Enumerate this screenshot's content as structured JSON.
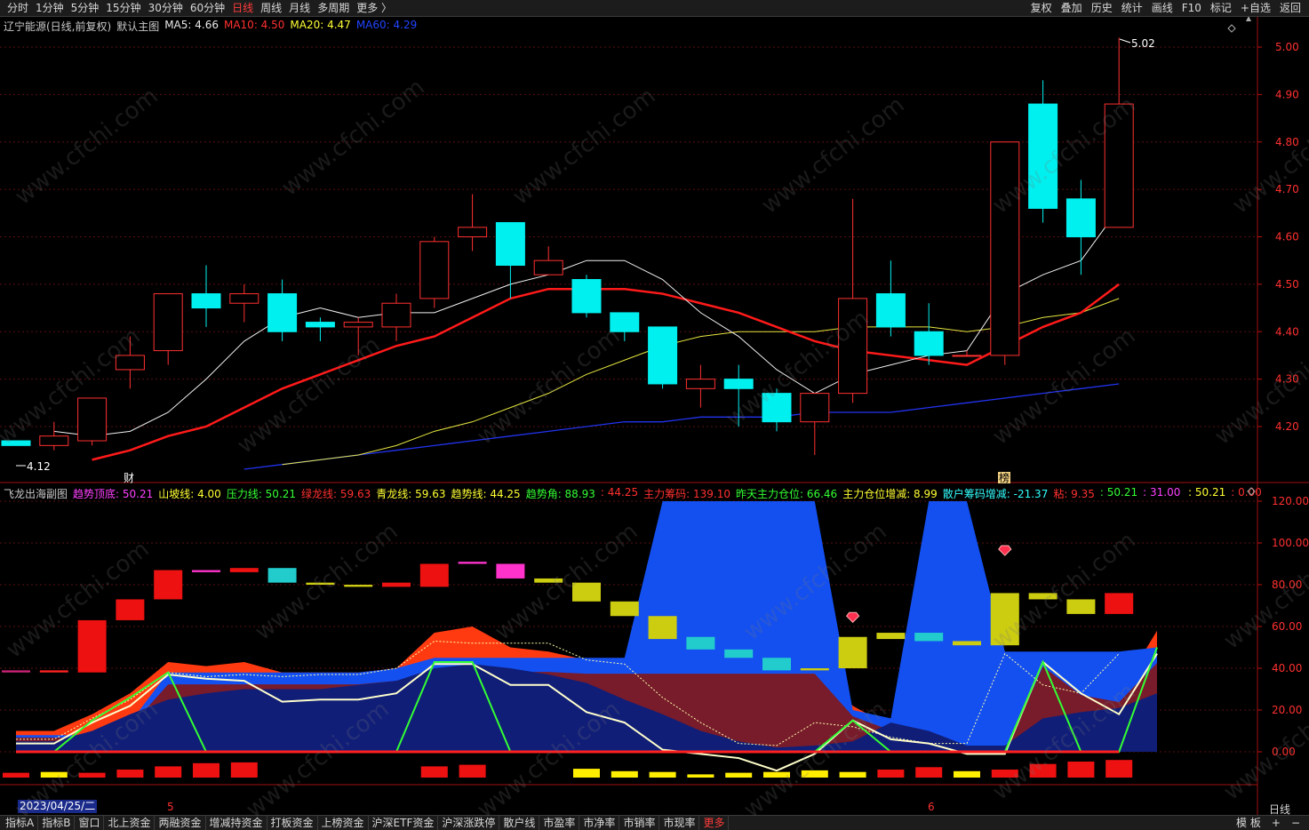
{
  "topbar": {
    "tabs": [
      "分时",
      "1分钟",
      "5分钟",
      "15分钟",
      "30分钟",
      "60分钟",
      "日线",
      "周线",
      "月线",
      "多周期",
      "更多 〉"
    ],
    "active": "日线",
    "right": [
      "复权",
      "叠加",
      "历史",
      "统计",
      "画线",
      "F10",
      "标记",
      "+自选",
      "返回"
    ]
  },
  "main_legend": [
    {
      "text": "辽宁能源(日线,前复权)",
      "color": "#c8c8c8"
    },
    {
      "text": "默认主图",
      "color": "#c8c8c8"
    },
    {
      "text": "MA5: 4.66",
      "color": "#e8e8e8"
    },
    {
      "text": "MA10: 4.50",
      "color": "#ff3030"
    },
    {
      "text": "MA20: 4.47",
      "color": "#ffff33"
    },
    {
      "text": "MA60: 4.29",
      "color": "#2244ff"
    }
  ],
  "sub_legend": [
    {
      "text": "飞龙出海副图",
      "color": "#c8c8c8"
    },
    {
      "text": "趋势顶底: 50.21",
      "color": "#ff40ff"
    },
    {
      "text": "山坡线: 4.00",
      "color": "#ffff33"
    },
    {
      "text": "压力线: 50.21",
      "color": "#33ff33"
    },
    {
      "text": "绿龙线: 59.63",
      "color": "#ff3030"
    },
    {
      "text": "青龙线: 59.63",
      "color": "#ffff33"
    },
    {
      "text": "趋势线: 44.25",
      "color": "#ffff33"
    },
    {
      "text": "趋势角: 88.93",
      "color": "#33ff33"
    },
    {
      "text": ": 44.25",
      "color": "#ff3030"
    },
    {
      "text": "主力筹码: 139.10",
      "color": "#ff3030"
    },
    {
      "text": "昨天主力仓位: 66.46",
      "color": "#33ff33"
    },
    {
      "text": "主力仓位增减: 8.99",
      "color": "#ffff33"
    },
    {
      "text": "散户筹码增减: -21.37",
      "color": "#33ffff"
    },
    {
      "text": "粘: 9.35",
      "color": "#ff3030"
    },
    {
      "text": ": 50.21",
      "color": "#33ff33"
    },
    {
      "text": ": 31.00",
      "color": "#ff40ff"
    }
  ],
  "sub_legend_right": [
    {
      "text": ": 50.21",
      "color": "#ffff33"
    },
    {
      "text": ": 0.00",
      "color": "#ff3030"
    }
  ],
  "price_axis": [
    "5.00",
    "4.90",
    "4.80",
    "4.70",
    "4.60",
    "4.50",
    "4.40",
    "4.30",
    "4.20"
  ],
  "sub_axis": [
    "120.00",
    "100.00",
    "80.00",
    "60.00",
    "40.00",
    "20.00",
    "0.00"
  ],
  "annotations": {
    "high": "5.02",
    "low": "4.12",
    "cai": "财",
    "bang": "榜",
    "month5": "5",
    "month6": "6"
  },
  "candles": [
    [
      4.17,
      4.16,
      4.17,
      4.16
    ],
    [
      4.16,
      4.18,
      4.21,
      4.15
    ],
    [
      4.17,
      4.26,
      4.26,
      4.16
    ],
    [
      4.32,
      4.35,
      4.39,
      4.28
    ],
    [
      4.36,
      4.48,
      4.48,
      4.33
    ],
    [
      4.48,
      4.45,
      4.54,
      4.41
    ],
    [
      4.46,
      4.48,
      4.5,
      4.42
    ],
    [
      4.48,
      4.4,
      4.51,
      4.38
    ],
    [
      4.42,
      4.41,
      4.43,
      4.38
    ],
    [
      4.41,
      4.42,
      4.43,
      4.35
    ],
    [
      4.41,
      4.46,
      4.48,
      4.38
    ],
    [
      4.47,
      4.59,
      4.6,
      4.45
    ],
    [
      4.6,
      4.62,
      4.69,
      4.57
    ],
    [
      4.63,
      4.54,
      4.63,
      4.47
    ],
    [
      4.52,
      4.55,
      4.58,
      4.52
    ],
    [
      4.51,
      4.44,
      4.52,
      4.43
    ],
    [
      4.44,
      4.4,
      4.44,
      4.38
    ],
    [
      4.41,
      4.29,
      4.41,
      4.28
    ],
    [
      4.28,
      4.3,
      4.33,
      4.24
    ],
    [
      4.3,
      4.28,
      4.33,
      4.2
    ],
    [
      4.27,
      4.21,
      4.28,
      4.19
    ],
    [
      4.21,
      4.27,
      4.27,
      4.14
    ],
    [
      4.27,
      4.47,
      4.68,
      4.25
    ],
    [
      4.48,
      4.41,
      4.55,
      4.39
    ],
    [
      4.4,
      4.35,
      4.46,
      4.33
    ],
    [
      4.35,
      4.35,
      4.36,
      4.35
    ],
    [
      4.35,
      4.8,
      4.8,
      4.33
    ],
    [
      4.88,
      4.66,
      4.93,
      4.63
    ],
    [
      4.68,
      4.6,
      4.72,
      4.52
    ],
    [
      4.62,
      4.88,
      5.02,
      4.62
    ]
  ],
  "ma5": [
    4.19,
    4.18,
    4.19,
    4.23,
    4.3,
    4.38,
    4.43,
    4.45,
    4.43,
    4.44,
    4.44,
    4.47,
    4.5,
    4.52,
    4.55,
    4.55,
    4.51,
    4.44,
    4.39,
    4.32,
    4.27,
    4.31,
    4.33,
    4.35,
    4.36,
    4.48,
    4.52,
    4.55,
    4.66
  ],
  "ma10": [
    4.13,
    4.15,
    4.18,
    4.2,
    4.24,
    4.28,
    4.31,
    4.34,
    4.37,
    4.39,
    4.43,
    4.47,
    4.49,
    4.49,
    4.49,
    4.48,
    4.46,
    4.44,
    4.41,
    4.38,
    4.36,
    4.35,
    4.34,
    4.33,
    4.37,
    4.41,
    4.44,
    4.5
  ],
  "ma20": [
    4.12,
    4.13,
    4.14,
    4.16,
    4.19,
    4.21,
    4.24,
    4.27,
    4.31,
    4.34,
    4.37,
    4.39,
    4.4,
    4.4,
    4.4,
    4.41,
    4.41,
    4.41,
    4.4,
    4.41,
    4.43,
    4.44,
    4.47
  ],
  "ma60": [
    4.11,
    4.12,
    4.13,
    4.14,
    4.15,
    4.16,
    4.17,
    4.18,
    4.19,
    4.2,
    4.21,
    4.21,
    4.22,
    4.22,
    4.22,
    4.23,
    4.23,
    4.23,
    4.24,
    4.25,
    4.26,
    4.27,
    4.28,
    4.29
  ],
  "sub": {
    "dark_blue": [
      5,
      5,
      10,
      18,
      25,
      28,
      30,
      30,
      30,
      32,
      34,
      40,
      42,
      40,
      37,
      33,
      25,
      18,
      10,
      5,
      2,
      3,
      5,
      14,
      10,
      3,
      3,
      16,
      19,
      21,
      28
    ],
    "white_line": [
      4,
      4,
      14,
      22,
      37,
      35,
      34,
      24,
      25,
      25,
      28,
      42,
      42,
      32,
      32,
      19,
      14,
      1,
      -1,
      -3,
      -9,
      -1,
      15,
      6,
      4,
      -1,
      -1,
      43,
      28,
      18,
      47
    ],
    "yellow_dash": [
      6,
      6,
      16,
      25,
      38,
      36,
      37,
      36,
      37,
      37,
      40,
      53,
      52,
      52,
      52,
      44,
      42,
      26,
      14,
      4,
      3,
      14,
      12,
      7,
      4,
      4,
      47,
      32,
      28,
      47
    ],
    "trend_green": [
      0,
      0,
      15,
      26,
      38,
      0,
      0,
      0,
      0,
      0,
      0,
      43,
      43,
      0,
      0,
      0,
      0,
      0,
      0,
      0,
      0,
      0,
      15,
      0,
      0,
      0,
      0,
      43,
      0,
      0,
      50
    ],
    "red_fill": [
      10,
      10,
      18,
      28,
      43,
      41,
      43,
      38,
      38,
      38,
      40,
      57,
      60,
      50,
      48,
      44,
      44,
      44,
      44,
      44,
      44,
      44,
      22,
      12,
      0,
      0,
      0,
      48,
      32,
      28,
      58
    ],
    "blue_bright": [
      8,
      8,
      8,
      14,
      38,
      38,
      38,
      38,
      38,
      38,
      40,
      45,
      45,
      45,
      45,
      45,
      45,
      120,
      120,
      120,
      120,
      120,
      20,
      16,
      120,
      120,
      48,
      48,
      48,
      48,
      50
    ],
    "bars": [
      {
        "b": 38,
        "t": 39,
        "c": "#cc2277"
      },
      {
        "b": 38,
        "t": 39,
        "c": "#ff2222"
      },
      {
        "b": 38,
        "t": 63,
        "c": "#ee1111"
      },
      {
        "b": 63,
        "t": 73,
        "c": "#ee1111"
      },
      {
        "b": 73,
        "t": 87,
        "c": "#ee1111"
      },
      {
        "b": 86,
        "t": 87,
        "c": "#ff33cc"
      },
      {
        "b": 86,
        "t": 88,
        "c": "#ee1111"
      },
      {
        "b": 81,
        "t": 88,
        "c": "#22cccc"
      },
      {
        "b": 80,
        "t": 81,
        "c": "#cccc11"
      },
      {
        "b": 79,
        "t": 80,
        "c": "#cccc11"
      },
      {
        "b": 79,
        "t": 81,
        "c": "#ee1111"
      },
      {
        "b": 79,
        "t": 90,
        "c": "#ee1111"
      },
      {
        "b": 90,
        "t": 91,
        "c": "#ff33cc"
      },
      {
        "b": 83,
        "t": 90,
        "c": "#ff33cc"
      },
      {
        "b": 81,
        "t": 83,
        "c": "#cccc11"
      },
      {
        "b": 72,
        "t": 81,
        "c": "#cccc11"
      },
      {
        "b": 65,
        "t": 72,
        "c": "#cccc11"
      },
      {
        "b": 54,
        "t": 65,
        "c": "#cccc11"
      },
      {
        "b": 49,
        "t": 55,
        "c": "#22cccc"
      },
      {
        "b": 45,
        "t": 49,
        "c": "#22cccc"
      },
      {
        "b": 39,
        "t": 45,
        "c": "#22cccc"
      },
      {
        "b": 39,
        "t": 40,
        "c": "#cccc11"
      },
      {
        "b": 40,
        "t": 55,
        "c": "#cccc11"
      },
      {
        "b": 54,
        "t": 57,
        "c": "#cccc11"
      },
      {
        "b": 53,
        "t": 57,
        "c": "#22cccc"
      },
      {
        "b": 51,
        "t": 53,
        "c": "#cccc11"
      },
      {
        "b": 51,
        "t": 76,
        "c": "#cccc11"
      },
      {
        "b": 73,
        "t": 76,
        "c": "#cccc11"
      },
      {
        "b": 66,
        "t": 73,
        "c": "#cccc11"
      },
      {
        "b": 66,
        "t": 76,
        "c": "#ee1111"
      }
    ],
    "bottom": [
      {
        "h": 0.3,
        "c": "#ee1111"
      },
      {
        "h": 0.35,
        "c": "#ffee00"
      },
      {
        "h": 0.3,
        "c": "#ee1111"
      },
      {
        "h": 0.5,
        "c": "#ee1111"
      },
      {
        "h": 0.7,
        "c": "#ee1111"
      },
      {
        "h": 0.9,
        "c": "#ee1111"
      },
      {
        "h": 0.95,
        "c": "#ee1111"
      },
      {
        "h": 0,
        "c": "#000"
      },
      {
        "h": 0,
        "c": "#000"
      },
      {
        "h": 0,
        "c": "#000"
      },
      {
        "h": 0,
        "c": "#000"
      },
      {
        "h": 0.7,
        "c": "#ee1111"
      },
      {
        "h": 0.8,
        "c": "#ee1111"
      },
      {
        "h": 0,
        "c": "#000"
      },
      {
        "h": 0,
        "c": "#000"
      },
      {
        "h": 0.55,
        "c": "#ffee00"
      },
      {
        "h": 0.4,
        "c": "#ffee00"
      },
      {
        "h": 0.35,
        "c": "#ffee00"
      },
      {
        "h": 0.2,
        "c": "#ffee00"
      },
      {
        "h": 0.3,
        "c": "#ffee00"
      },
      {
        "h": 0.35,
        "c": "#ffee00"
      },
      {
        "h": 0.45,
        "c": "#ffee00"
      },
      {
        "h": 0.35,
        "c": "#ffee00"
      },
      {
        "h": 0.5,
        "c": "#ee1111"
      },
      {
        "h": 0.65,
        "c": "#ee1111"
      },
      {
        "h": 0.4,
        "c": "#ffee00"
      },
      {
        "h": 0.5,
        "c": "#ee1111"
      },
      {
        "h": 0.85,
        "c": "#ee1111"
      },
      {
        "h": 1.0,
        "c": "#ee1111"
      },
      {
        "h": 1.1,
        "c": "#ee1111"
      }
    ]
  },
  "bottom_date": "2023/04/25/二",
  "period_label": "日线",
  "bottombar": {
    "tabs": [
      "指标A",
      "指标B",
      "窗口",
      "北上资金",
      "两融资金",
      "增减持资金",
      "打板资金",
      "上榜资金",
      "沪深ETF资金",
      "沪深涨跌停",
      "散户线",
      "市盈率",
      "市净率",
      "市销率",
      "市现率",
      "更多"
    ],
    "right": [
      "模 板",
      "+",
      "−"
    ]
  },
  "watermark": "www.cfchi.com"
}
